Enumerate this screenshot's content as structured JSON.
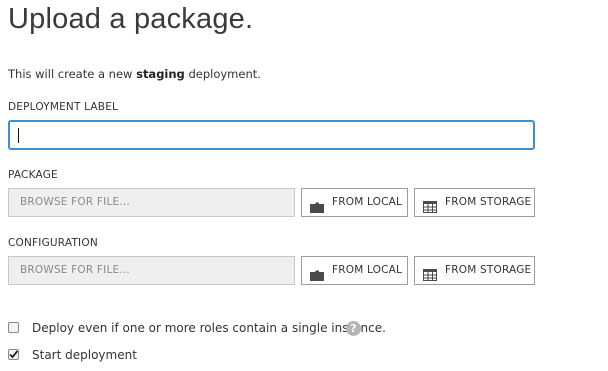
{
  "page": {
    "title": "Upload a package.",
    "intro_prefix": "This will create a new ",
    "intro_bold": "staging",
    "intro_suffix": " deployment."
  },
  "deployment_label": {
    "label": "DEPLOYMENT LABEL",
    "value": ""
  },
  "package": {
    "label": "PACKAGE",
    "placeholder": "BROWSE FOR FILE...",
    "from_local": "FROM LOCAL",
    "from_storage": "FROM STORAGE"
  },
  "configuration": {
    "label": "CONFIGURATION",
    "placeholder": "BROWSE FOR FILE...",
    "from_local": "FROM LOCAL",
    "from_storage": "FROM STORAGE"
  },
  "options": {
    "deploy_single_instance": {
      "label": "Deploy even if one or more roles contain a single instance.",
      "checked": false,
      "help": "?"
    },
    "start_deployment": {
      "label": "Start deployment",
      "checked": true
    }
  },
  "colors": {
    "input_focus_border": "#3e8fd1",
    "field_background": "#efefef",
    "button_border": "#9d9d9d"
  },
  "icons": {
    "local": "folder-icon",
    "storage": "storage-table-icon",
    "help": "help-icon"
  }
}
